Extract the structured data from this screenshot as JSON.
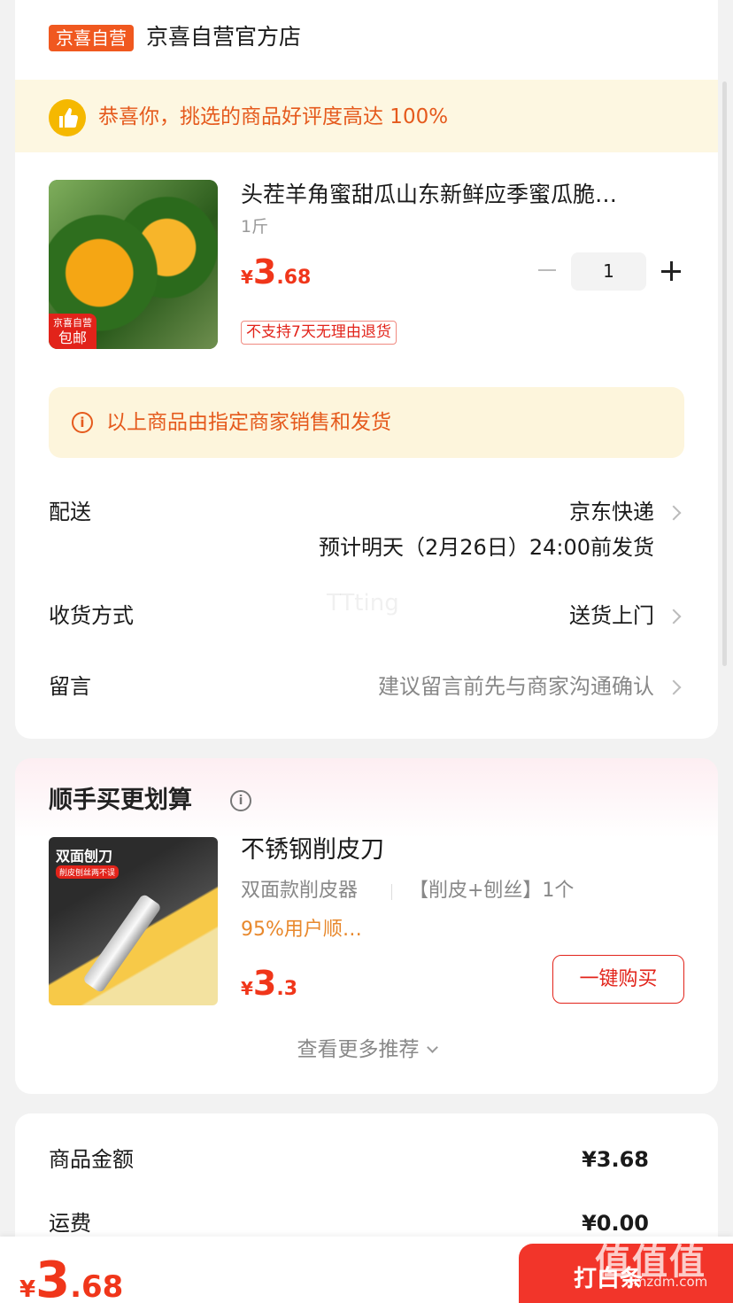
{
  "store": {
    "badge": "京喜自营",
    "name": "京喜自营官方店"
  },
  "praise": {
    "text": "恭喜你，挑选的商品好评度高达 100%"
  },
  "product": {
    "title": "头茬羊角蜜甜瓜山东新鲜应季蜜瓜脆…",
    "spec": "1斤",
    "price_symbol": "¥",
    "price_int": "3",
    "price_dec": ".68",
    "quantity": "1",
    "image_tag_top": "京喜自营",
    "image_tag_bottom": "包邮",
    "return_policy": "不支持7天无理由退货"
  },
  "notice": {
    "text": "以上商品由指定商家销售和发货",
    "icon": "info-icon"
  },
  "delivery": {
    "label": "配送",
    "carrier": "京东快递",
    "estimate": "预计明天（2月26日）24:00前发货"
  },
  "receive": {
    "label": "收货方式",
    "value": "送货上门"
  },
  "message": {
    "label": "留言",
    "placeholder": "建议留言前先与商家沟通确认"
  },
  "recommend": {
    "title": "顺手买更划算",
    "item": {
      "image_label": "双面刨刀",
      "image_sublabel": "削皮刨丝两不误",
      "name": "不锈钢削皮刀",
      "spec1": "双面款削皮器",
      "spec2": "【削皮+刨丝】1个",
      "promo": "95%用户顺…",
      "price_symbol": "¥",
      "price_int": "3",
      "price_dec": ".3",
      "buy_label": "一键购买"
    },
    "more_label": "查看更多推荐"
  },
  "amounts": {
    "goods_label": "商品金额",
    "goods_value": "¥3.68",
    "shipping_label": "运费",
    "shipping_value": "¥0.00"
  },
  "bottom_bar": {
    "total_symbol": "¥",
    "total_int": "3",
    "total_dec": ".68",
    "pay_label": "打白条"
  },
  "watermarks": {
    "center": "TTting",
    "logo": "值值值",
    "url": "smzdm.com"
  },
  "colors": {
    "accent_red": "#f0361a",
    "badge_orange": "#f0581f",
    "notice_text": "#e55a1d",
    "praise_bg": "#fdf7e1"
  }
}
